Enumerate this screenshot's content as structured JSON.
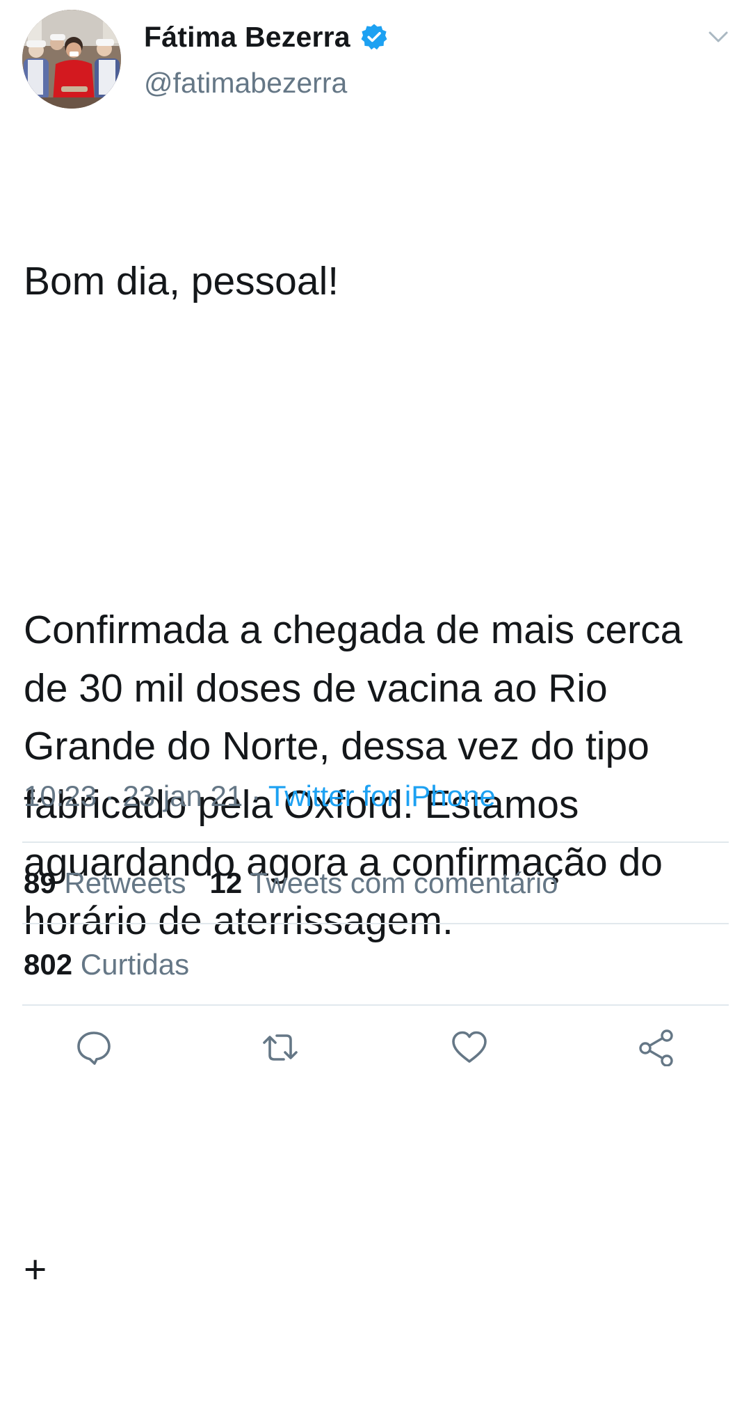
{
  "author": {
    "display_name": "Fátima Bezerra",
    "handle": "@fatimabezerra",
    "verified": true
  },
  "tweet": {
    "paragraphs": [
      "Bom dia, pessoal!",
      "Confirmada a chegada de mais cerca de 30 mil doses de vacina ao Rio Grande do Norte, dessa vez do tipo fabricado pela Oxford. Estamos aguardando agora a confirmação do horário de aterrissagem.",
      "+"
    ]
  },
  "meta": {
    "time": "10:23",
    "date": "23 jan 21",
    "separator": "·",
    "source": "Twitter for iPhone"
  },
  "stats": {
    "retweets_count": "89",
    "retweets_label": "Retweets",
    "quotes_count": "12",
    "quotes_label": "Tweets com comentário",
    "likes_count": "802",
    "likes_label": "Curtidas"
  },
  "colors": {
    "link": "#1da1f2",
    "secondary_text": "#657786",
    "primary_text": "#14171a",
    "divider": "#e1e8ed"
  },
  "icons": {
    "menu": "chevron-down-icon",
    "verified": "verified-badge-icon",
    "reply": "reply-icon",
    "retweet": "retweet-icon",
    "like": "heart-icon",
    "share": "share-icon"
  }
}
